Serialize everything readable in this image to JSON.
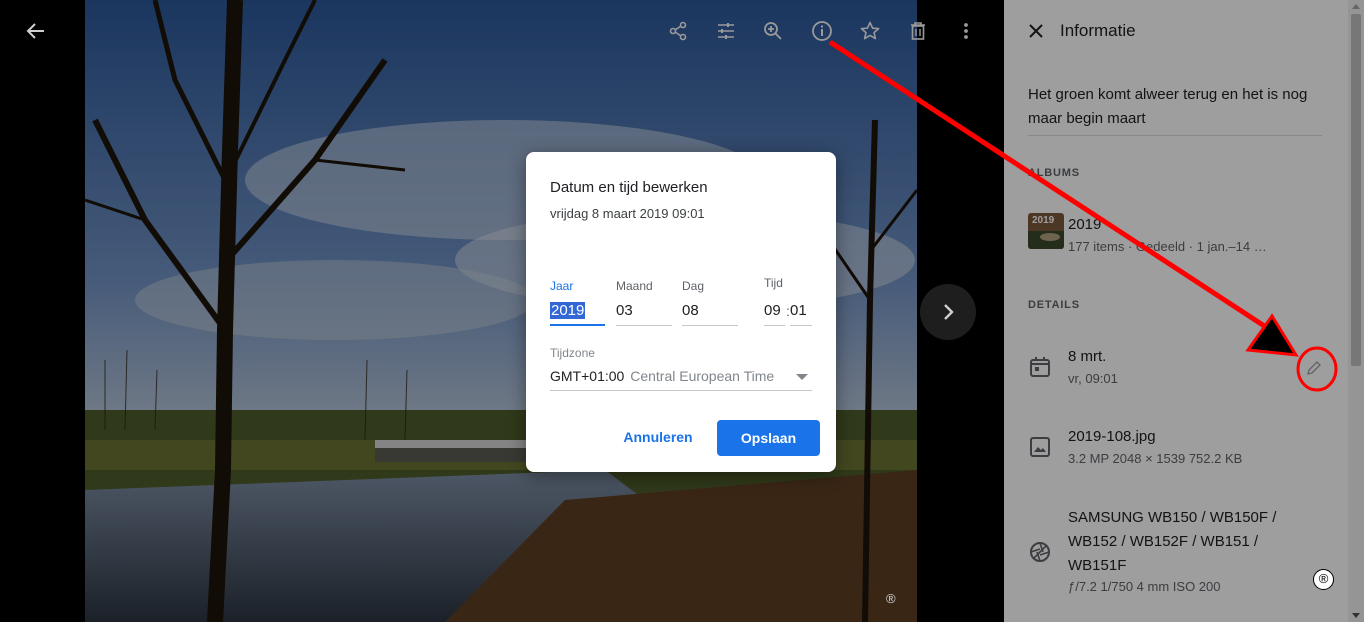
{
  "viewer": {
    "toolbar": [
      "share-icon",
      "edit-icon",
      "zoom-in-icon",
      "info-icon",
      "star-icon",
      "delete-icon",
      "more-icon"
    ],
    "watermark": "®"
  },
  "panel": {
    "title": "Informatie",
    "description": "Het groen komt alweer terug en het is nog maar begin maart",
    "albums_heading": "ALBUMS",
    "album": {
      "thumb_label": "2019",
      "title": "2019",
      "subtitle": "177 items  ·  Gedeeld  ·  1 jan.–14 …"
    },
    "details_heading": "DETAILS",
    "date": {
      "title": "8 mrt.",
      "subtitle": "vr, 09:01"
    },
    "file": {
      "title": "2019-108.jpg",
      "subtitle": "3.2 MP    2048 × 1539    752.2 KB"
    },
    "camera": {
      "line1": "SAMSUNG WB150 / WB150F /",
      "line2": "WB152 / WB152F / WB151 /",
      "line3": "WB151F",
      "subtitle": "ƒ/7.2    1/750    4 mm    ISO 200"
    }
  },
  "dialog": {
    "title": "Datum en tijd bewerken",
    "subtitle": "vrijdag 8 maart 2019 09:01",
    "year_label": "Jaar",
    "year_value": "2019",
    "month_label": "Maand",
    "month_value": "03",
    "day_label": "Dag",
    "day_value": "08",
    "time_label": "Tijd",
    "hour_value": "09",
    "minute_value": "01",
    "time_separator": ":",
    "timezone_label": "Tijdzone",
    "timezone_offset": "GMT+01:00",
    "timezone_name": "Central European Time",
    "cancel_label": "Annuleren",
    "save_label": "Opslaan"
  },
  "annotation": {
    "color": "#ff0000",
    "reg_mark": "®"
  }
}
